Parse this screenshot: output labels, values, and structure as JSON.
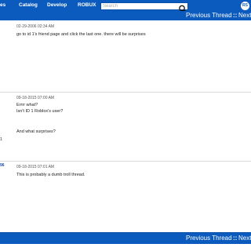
{
  "nav": {
    "items": [
      {
        "label": "es"
      },
      {
        "label": "Catalog"
      },
      {
        "label": "Develop"
      },
      {
        "label": "ROBUX"
      }
    ],
    "search_placeholder": "Search",
    "search_icon": "magnifier-icon",
    "robux_icon_text": "RS"
  },
  "thread_nav": {
    "previous_label": "Previous Thread",
    "separator": "::",
    "next_label": "Next"
  },
  "posts": [
    {
      "timestamp": "02-29-2006 02:34 AM",
      "lines": [
        "go to id 1's friend page and click the last one. there will be surprises"
      ],
      "side_fragment": ""
    },
    {
      "timestamp": "09-18-2015 07:00 AM",
      "lines": [
        "Errrr what?",
        "Isn't ID 1 Roblox's user?",
        "And what surprises?"
      ],
      "side_fragment": "1"
    },
    {
      "timestamp": "09-18-2015 07:01 AM",
      "lines": [
        "This is probably a dumb troll thread."
      ],
      "side_fragment": "96"
    }
  ],
  "colors": {
    "accent": "#0b5bbf",
    "divider": "#d9d9d9"
  }
}
